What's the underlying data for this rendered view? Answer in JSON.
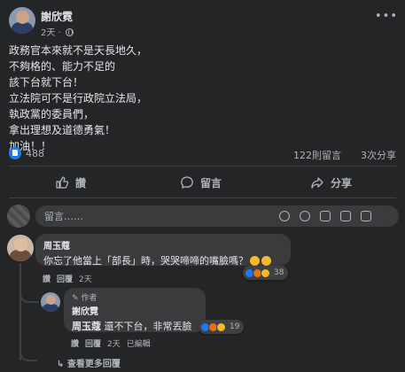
{
  "post": {
    "author": "謝欣霓",
    "time": "2天",
    "body_lines": [
      "政務官本來就不是天長地久，",
      "不夠格的、能力不足的",
      "該下台就下台！",
      "立法院可不是行政院立法局，",
      "執政黨的委員們，",
      "拿出理想及道德勇氣！",
      "加油！！"
    ],
    "likes": "488",
    "comments": "122則留言",
    "shares": "3次分享"
  },
  "actions": {
    "like": "讚",
    "comment": "留言",
    "share": "分享"
  },
  "comment_box": {
    "placeholder": "留言……"
  },
  "comments": [
    {
      "author": "周玉蔻",
      "text": "你忘了他當上「部長」時，哭哭啼啼的嘴臉嗎？",
      "like": "讚",
      "reply": "回覆",
      "time": "2天",
      "reaction_count": "38"
    }
  ],
  "reply": {
    "tag": "作者",
    "author": "謝欣霓",
    "mention": "周玉蔻",
    "text": " 還不下台，非常丟臉",
    "like": "讚",
    "reply": "回覆",
    "time": "2天",
    "edited": "已編輯",
    "reaction_count": "19"
  },
  "more_replies": "查看更多回覆",
  "colors": {
    "background": "#242526",
    "bubble": "#3a3b3c",
    "like_blue": "#2078f4",
    "haha_yellow": "#f7b928",
    "angry_orange": "#e9710f",
    "text": "#e4e6eb",
    "secondary_text": "#b0b3b8"
  }
}
